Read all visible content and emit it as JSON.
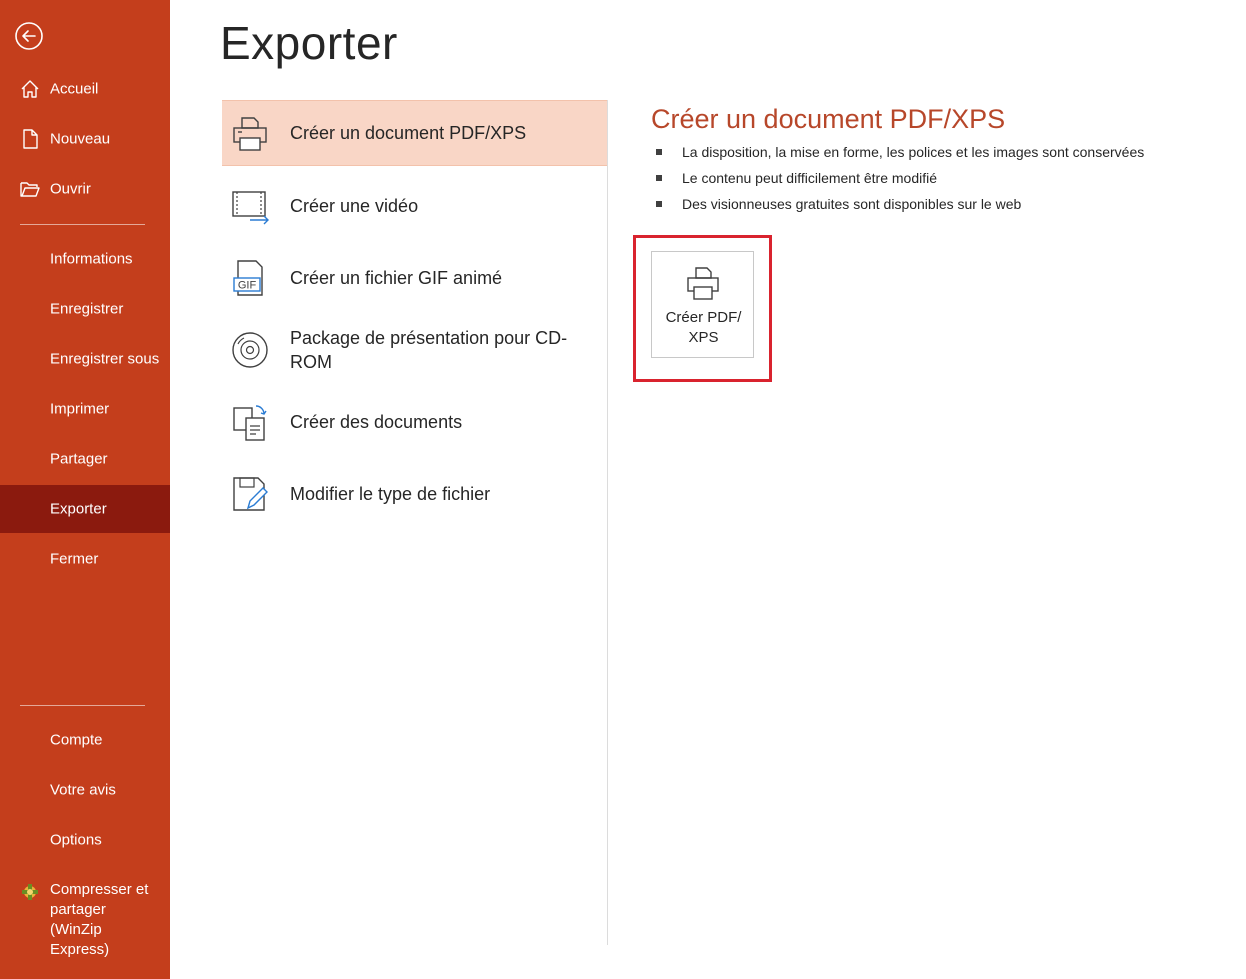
{
  "sidebar": {
    "items": [
      {
        "label": "Accueil"
      },
      {
        "label": "Nouveau"
      },
      {
        "label": "Ouvrir"
      },
      {
        "label": "Informations"
      },
      {
        "label": "Enregistrer"
      },
      {
        "label": "Enregistrer sous"
      },
      {
        "label": "Imprimer"
      },
      {
        "label": "Partager"
      },
      {
        "label": "Exporter"
      },
      {
        "label": "Fermer"
      },
      {
        "label": "Compte"
      },
      {
        "label": "Votre avis"
      },
      {
        "label": "Options"
      },
      {
        "label": "Compresser et partager (WinZip Express)"
      }
    ],
    "active_item": "Exporter",
    "colors": {
      "background": "#c43e1c",
      "active": "#8b1a0e"
    }
  },
  "main": {
    "title": "Exporter",
    "options": [
      {
        "label": "Créer un document PDF/XPS",
        "icon": "pdf-printer-icon",
        "selected": true
      },
      {
        "label": "Créer une vidéo",
        "icon": "video-icon"
      },
      {
        "label": "Créer un fichier GIF animé",
        "icon": "gif-icon",
        "icon_text": "GIF"
      },
      {
        "label": "Package de présentation pour CD-ROM",
        "icon": "cd-icon"
      },
      {
        "label": "Créer des documents",
        "icon": "documents-icon"
      },
      {
        "label": "Modifier le type de fichier",
        "icon": "file-type-icon"
      }
    ]
  },
  "detail": {
    "title": "Créer un document PDF/XPS",
    "bullets": [
      "La disposition, la mise en forme, les polices et les images sont conservées",
      "Le contenu peut difficilement être modifié",
      "Des visionneuses gratuites sont disponibles sur le web"
    ],
    "button_label": "Créer PDF/ XPS",
    "accent_color": "#b7472a",
    "highlight_color": "#d9232e"
  }
}
